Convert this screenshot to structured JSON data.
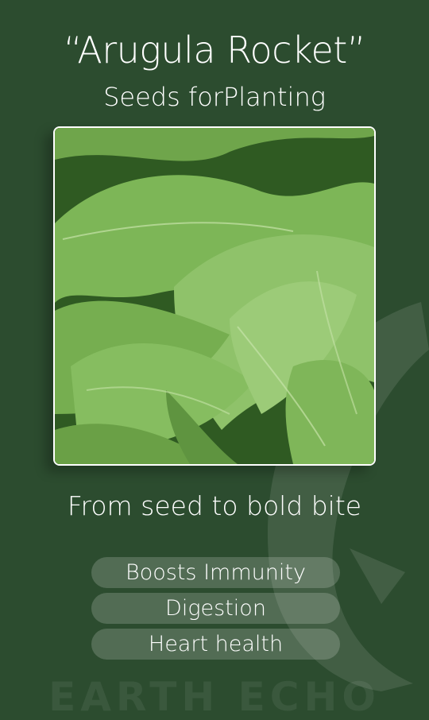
{
  "product": {
    "title": "“Arugula Rocket”",
    "subtitle": "Seeds forPlanting"
  },
  "photo": {
    "subject": "arugula-leaves-photo"
  },
  "tagline": "From seed to bold bite",
  "benefits": [
    "Boosts Immunity",
    "Digestion",
    "Heart health"
  ],
  "brand": "EARTH ECHO",
  "colors": {
    "background": "#2c4c2f",
    "text": "#ffffff",
    "pill": "rgba(255,255,255,0.18)",
    "leaf_light": "#8fc26a",
    "leaf_dark": "#3d6e2d"
  }
}
